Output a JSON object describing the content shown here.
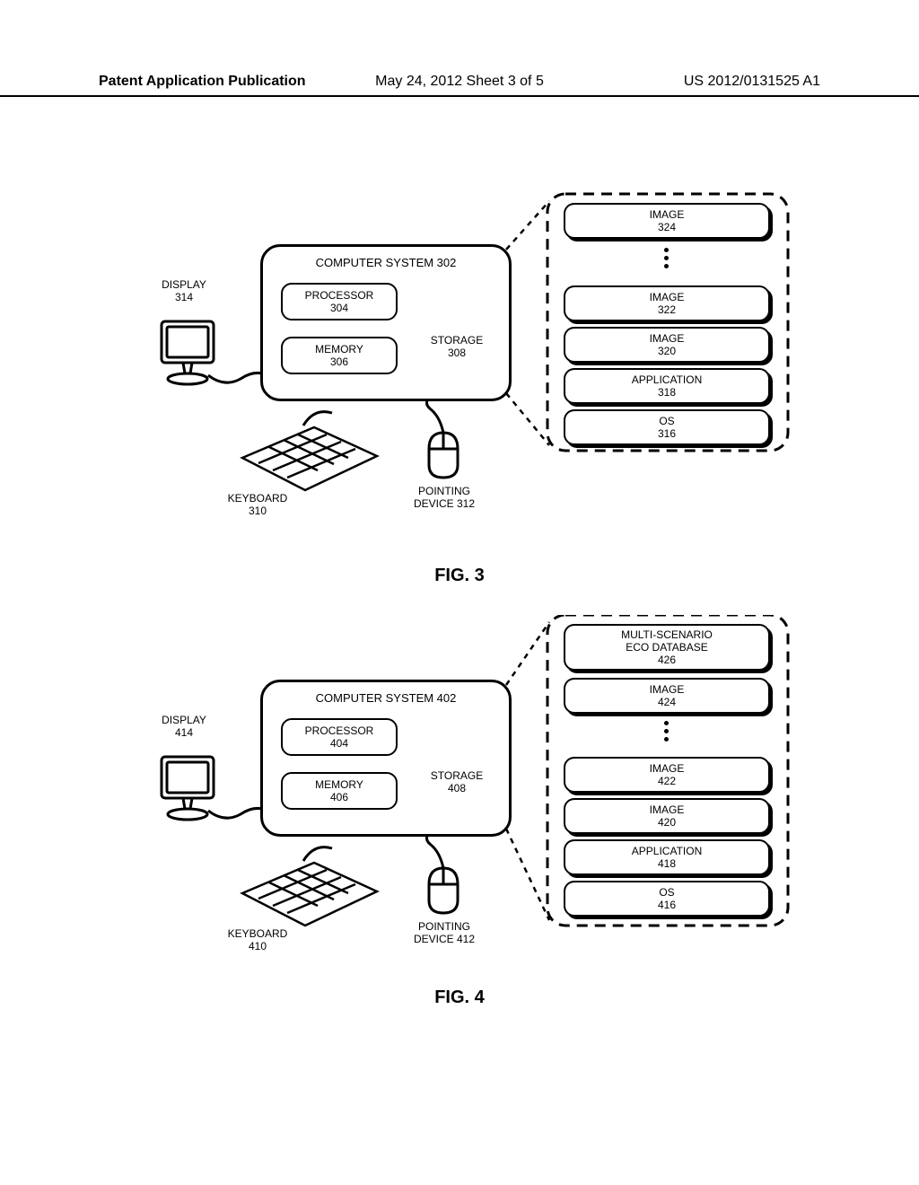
{
  "header": {
    "left": "Patent Application Publication",
    "mid": "May 24, 2012  Sheet 3 of 5",
    "right": "US 2012/0131525 A1"
  },
  "fig3": {
    "caption": "FIG. 3",
    "cs_title": "COMPUTER SYSTEM 302",
    "processor": "PROCESSOR\n304",
    "memory": "MEMORY\n306",
    "storage": "STORAGE\n308",
    "display": "DISPLAY\n314",
    "keyboard": "KEYBOARD\n310",
    "pointing": "POINTING\nDEVICE 312",
    "stack": {
      "os": "OS\n316",
      "application": "APPLICATION\n318",
      "image320": "IMAGE\n320",
      "image322": "IMAGE\n322",
      "image324": "IMAGE\n324"
    }
  },
  "fig4": {
    "caption": "FIG. 4",
    "cs_title": "COMPUTER SYSTEM 402",
    "processor": "PROCESSOR\n404",
    "memory": "MEMORY\n406",
    "storage": "STORAGE\n408",
    "display": "DISPLAY\n414",
    "keyboard": "KEYBOARD\n410",
    "pointing": "POINTING\nDEVICE 412",
    "stack": {
      "os": "OS\n416",
      "application": "APPLICATION\n418",
      "image420": "IMAGE\n420",
      "image422": "IMAGE\n422",
      "image424": "IMAGE\n424",
      "multi": "MULTI-SCENARIO\nECO DATABASE\n426"
    }
  }
}
